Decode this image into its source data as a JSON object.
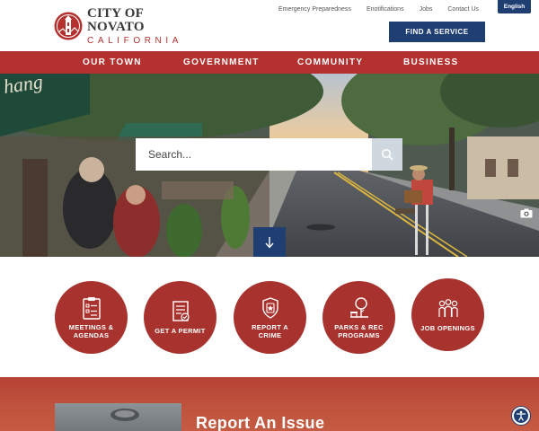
{
  "header": {
    "logo": {
      "line1": "CITY OF NOVATO",
      "line2": "CALIFORNIA",
      "seal_icon": "city-seal-icon"
    },
    "utility_links": [
      "Emergency Preparedness",
      "Enotifications",
      "Jobs",
      "Contact Us"
    ],
    "language_button": "English",
    "find_service_button": "FIND A SERVICE"
  },
  "nav": {
    "items": [
      "OUR TOWN",
      "GOVERNMENT",
      "COMMUNITY",
      "BUSINESS"
    ]
  },
  "hero": {
    "search": {
      "placeholder": "Search...",
      "value": ""
    },
    "icons": {
      "search": "search-icon",
      "scroll": "arrow-down-icon",
      "photo": "camera-icon"
    }
  },
  "quick_links": [
    {
      "label_lines": [
        "MEETINGS &",
        "AGENDAS"
      ],
      "icon": "clipboard-icon"
    },
    {
      "label_lines": [
        "GET A PERMIT"
      ],
      "icon": "permit-document-icon"
    },
    {
      "label_lines": [
        "REPORT A",
        "CRIME"
      ],
      "icon": "police-badge-icon"
    },
    {
      "label_lines": [
        "PARKS & REC",
        "PROGRAMS"
      ],
      "icon": "park-tree-icon"
    },
    {
      "label_lines": [
        "JOB OPENINGS"
      ],
      "icon": "people-group-icon"
    }
  ],
  "report_section": {
    "title": "Report An Issue"
  },
  "accessibility_icon": "accessibility-icon",
  "colors": {
    "brand_red": "#b5312f",
    "navy": "#1f3f73",
    "circle_red": "#a8332e",
    "search_button": "#cfd8df"
  }
}
